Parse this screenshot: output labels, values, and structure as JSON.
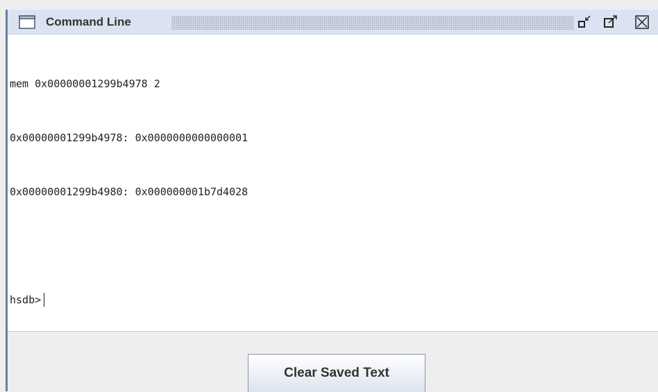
{
  "window": {
    "title": "Command Line",
    "title_icon": "window-icon",
    "controls": {
      "minimize_icon": "minimize-icon",
      "maximize_icon": "maximize-icon",
      "close_icon": "close-icon"
    }
  },
  "console": {
    "lines": [
      "mem 0x00000001299b4978 2",
      "0x00000001299b4978: 0x0000000000000001",
      "0x00000001299b4980: 0x000000001b7d4028",
      ""
    ],
    "prompt": "hsdb>"
  },
  "footer": {
    "clear_label": "Clear Saved Text"
  },
  "colors": {
    "titlebar_bg": "#dbe3f2",
    "left_edge": "#6a7ea8",
    "console_bg": "#ffffff",
    "panel_bg": "#eeeeee"
  }
}
